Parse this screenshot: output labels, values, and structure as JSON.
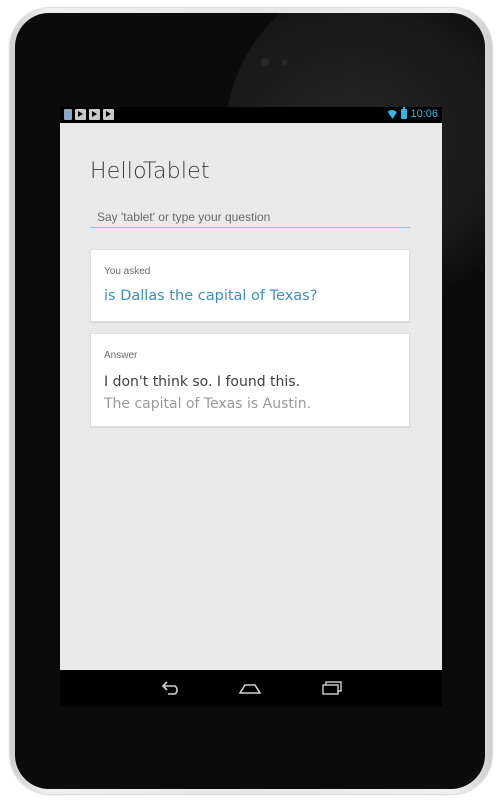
{
  "status_bar": {
    "time": "10:06",
    "notification_icons": [
      "notification-icon",
      "play-icon",
      "play-icon",
      "play-icon"
    ],
    "wifi_icon": "wifi-icon",
    "battery_icon": "battery-icon"
  },
  "app": {
    "title": "HelloTablet",
    "search": {
      "placeholder": "Say 'tablet' or type your question",
      "value": ""
    }
  },
  "asked_card": {
    "label": "You asked",
    "question": "is Dallas the capital of Texas?"
  },
  "answer_card": {
    "label": "Answer",
    "line1": "I don't think so. I found this.",
    "line2": "The capital of Texas is Austin."
  },
  "nav_bar": {
    "buttons": [
      "back-icon",
      "home-icon",
      "recent-apps-icon"
    ]
  },
  "colors": {
    "accent": "#33b5e5",
    "question_text": "#3a8fc4",
    "screen_bg": "#ebebeb",
    "card_bg": "#ffffff"
  }
}
